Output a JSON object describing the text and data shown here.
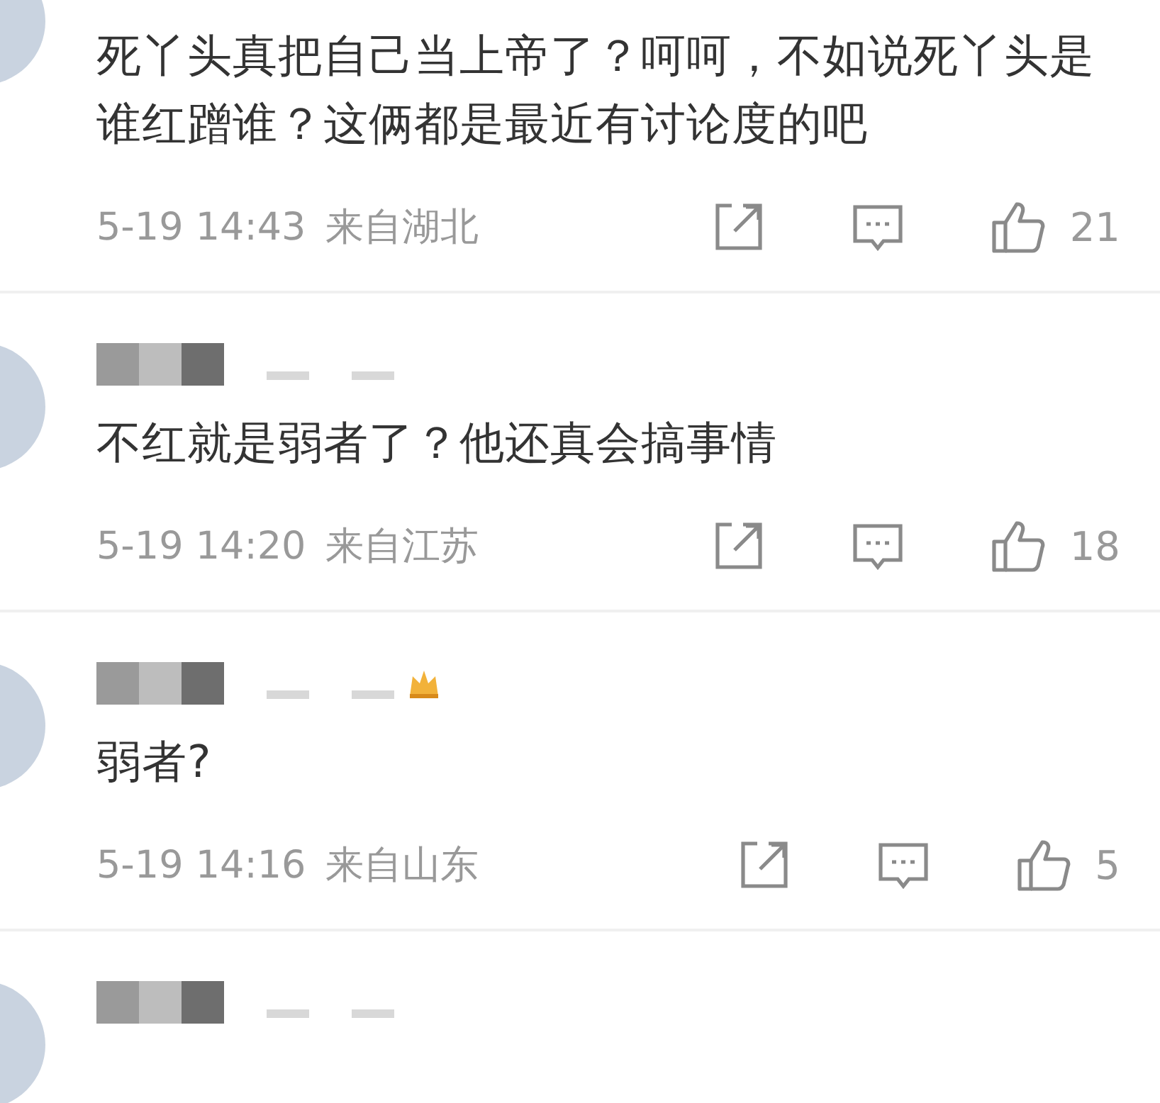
{
  "comments": [
    {
      "name_hidden": false,
      "badge": false,
      "text": "死丫头真把自己当上帝了？呵呵，不如说死丫头是谁红蹭谁？这俩都是最近有讨论度的吧",
      "time": "5-19 14:43",
      "location": "来自湖北",
      "likes": "21"
    },
    {
      "name_hidden": true,
      "badge": false,
      "text": "不红就是弱者了？他还真会搞事情",
      "time": "5-19 14:20",
      "location": "来自江苏",
      "likes": "18"
    },
    {
      "name_hidden": true,
      "badge": true,
      "text": "弱者?",
      "time": "5-19 14:16",
      "location": "来自山东",
      "likes": "5"
    },
    {
      "name_hidden": true,
      "badge": false
    }
  ]
}
